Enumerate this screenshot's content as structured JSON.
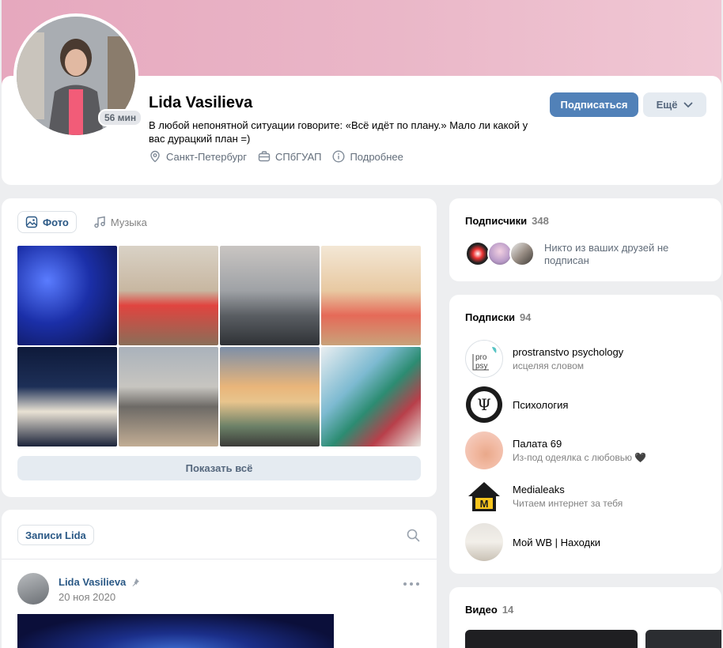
{
  "profile": {
    "name": "Lida Vasilieva",
    "online": "56 мин",
    "status": "В любой непонятной ситуации говорите: «Всё идёт по плану.» Мало ли какой у вас дурацкий план =)",
    "city": "Санкт-Петербург",
    "university": "СПбГУАП",
    "details": "Подробнее",
    "subscribe_label": "Подписаться",
    "more_label": "Ещё"
  },
  "media": {
    "tabs": [
      {
        "label": "Фото",
        "icon": "photo-icon"
      },
      {
        "label": "Музыка",
        "icon": "music-icon"
      }
    ],
    "show_all": "Показать всё"
  },
  "wall": {
    "tab_label": "Записи Lida",
    "post": {
      "author": "Lida Vasilieva",
      "date": "20 ноя 2020"
    }
  },
  "followers": {
    "title": "Подписчики",
    "count": "348",
    "note": "Никто из ваших друзей не подписан"
  },
  "subscriptions": {
    "title": "Подписки",
    "count": "94",
    "items": [
      {
        "name": "prostranstvo psychology",
        "desc": "исцеляя словом"
      },
      {
        "name": "Психология",
        "desc": ""
      },
      {
        "name": "Палата 69",
        "desc": "Из-под одеялка с любовью 🖤"
      },
      {
        "name": "Medialeaks",
        "desc": "Читаем интернет за тебя"
      },
      {
        "name": "Мой WB | Находки",
        "desc": ""
      }
    ]
  },
  "videos": {
    "title": "Видео",
    "count": "14"
  },
  "colors": {
    "accent": "#5181b8",
    "link": "#2a5885",
    "background": "#edeef0",
    "cover": "#eab7c8"
  }
}
